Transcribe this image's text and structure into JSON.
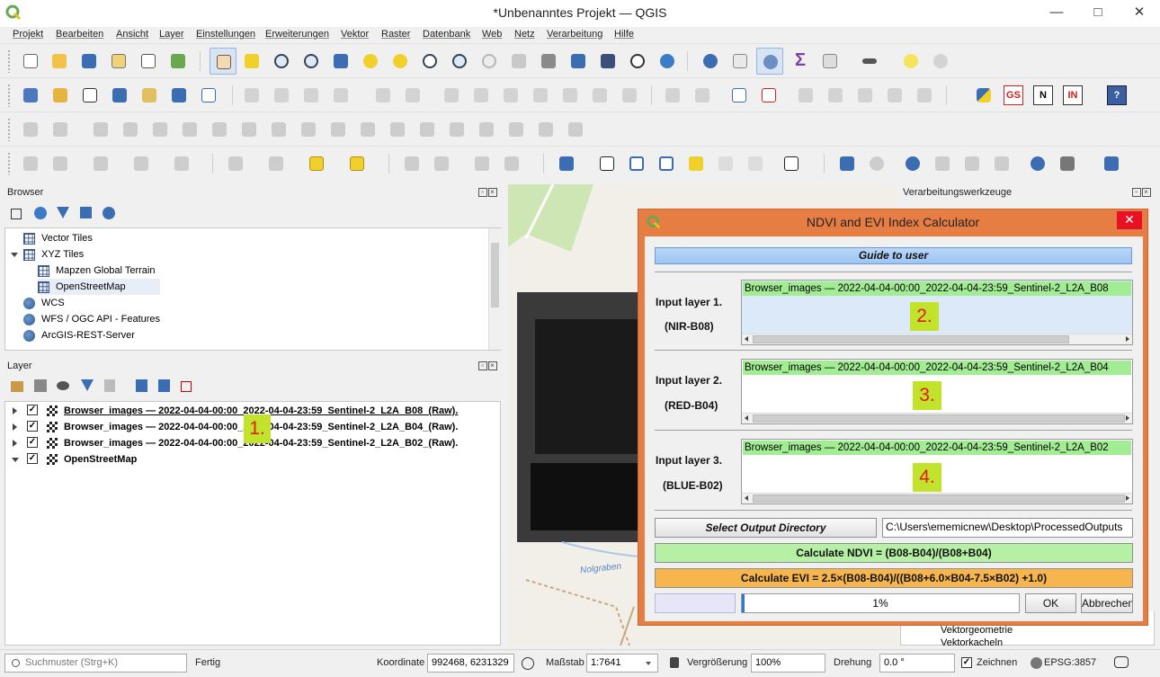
{
  "window": {
    "title": "*Unbenanntes Projekt — QGIS",
    "minimize_glyph": "—",
    "maximize_glyph": "□",
    "close_glyph": "✕"
  },
  "menu": [
    "Projekt",
    "Bearbeiten",
    "Ansicht",
    "Layer",
    "Einstellungen",
    "Erweiterungen",
    "Vektor",
    "Raster",
    "Datenbank",
    "Web",
    "Netz",
    "Verarbeitung",
    "Hilfe"
  ],
  "toolbar_text_icons": {
    "gs": "GS",
    "n": "N",
    "in": "IN",
    "help": "?"
  },
  "browser": {
    "title": "Browser",
    "items": [
      {
        "label": "Vector Tiles",
        "level": 0,
        "icon": "grid-icon"
      },
      {
        "label": "XYZ Tiles",
        "level": 0,
        "icon": "grid-icon",
        "expanded": true
      },
      {
        "label": "Mapzen Global Terrain",
        "level": 1,
        "icon": "grid-icon"
      },
      {
        "label": "OpenStreetMap",
        "level": 1,
        "icon": "grid-icon",
        "selected": true
      },
      {
        "label": "WCS",
        "level": 0,
        "icon": "globe-icon"
      },
      {
        "label": "WFS / OGC API - Features",
        "level": 0,
        "icon": "globe-icon"
      },
      {
        "label": "ArcGIS-REST-Server",
        "level": 0,
        "icon": "globe-icon"
      }
    ]
  },
  "layers": {
    "title": "Layer",
    "items": [
      {
        "label": "Browser_images — 2022-04-04-00:00_2022-04-04-23:59_Sentinel-2_L2A_B08_(Raw).",
        "checked": true,
        "type": "raster"
      },
      {
        "label": "Browser_images — 2022-04-04-00:00_2022-04-04-23:59_Sentinel-2_L2A_B04_(Raw).",
        "checked": true,
        "type": "raster"
      },
      {
        "label": "Browser_images — 2022-04-04-00:00_2022-04-04-23:59_Sentinel-2_L2A_B02_(Raw).",
        "checked": true,
        "type": "raster"
      },
      {
        "label": "OpenStreetMap",
        "checked": true,
        "type": "xyz"
      }
    ],
    "annotation": "1."
  },
  "processing": {
    "title": "Verarbeitungswerkzeuge",
    "visible_items": [
      "Vektorgeometrie",
      "Vektorkacheln"
    ]
  },
  "map": {
    "street_label": "Nolgraben"
  },
  "dialog": {
    "title": "NDVI and EVI Index Calculator",
    "guide_button": "Guide to user",
    "inputs": [
      {
        "label_line1": "Input layer 1.",
        "label_line2": "(NIR-B08)",
        "value": "Browser_images — 2022-04-04-00:00_2022-04-04-23:59_Sentinel-2_L2A_B08",
        "annotation": "2."
      },
      {
        "label_line1": "Input layer 2.",
        "label_line2": "(RED-B04)",
        "value": "Browser_images — 2022-04-04-00:00_2022-04-04-23:59_Sentinel-2_L2A_B04",
        "annotation": "3."
      },
      {
        "label_line1": "Input layer 3.",
        "label_line2": "(BLUE-B02)",
        "value": "Browser_images — 2022-04-04-00:00_2022-04-04-23:59_Sentinel-2_L2A_B02",
        "annotation": "4."
      }
    ],
    "output_button": "Select Output Directory",
    "output_path": "C:\\Users\\ememicnew\\Desktop\\ProcessedOutputs",
    "ndvi_button": "Calculate NDVI = (B08-B04)/(B08+B04)",
    "evi_button": "Calculate EVI = 2.5×(B08-B04)/((B08+6.0×B04-7.5×B02) +1.0)",
    "progress_label": "1%",
    "progress_fraction": 0.01,
    "ok": "OK",
    "cancel": "Abbrechen"
  },
  "statusbar": {
    "search_placeholder": "Suchmuster (Strg+K)",
    "status": "Fertig",
    "coord_label": "Koordinate",
    "coord_value": "992468, 6231329",
    "scale_label": "Maßstab",
    "scale_value": "1:7641",
    "zoom_label": "Vergrößerung",
    "zoom_value": "100%",
    "rotation_label": "Drehung",
    "rotation_value": "0.0 °",
    "render_label": "Zeichnen",
    "crs": "EPSG:3857"
  },
  "colors": {
    "dialog_frame": "#e67e43",
    "guide_button": "#9ec5f2",
    "layer_item_highlight": "#a2ec93",
    "ndvi_button": "#b6f0a4",
    "evi_button": "#f6b54d",
    "annotation_bg": "#c1e329",
    "annotation_text": "#e31a1c"
  }
}
